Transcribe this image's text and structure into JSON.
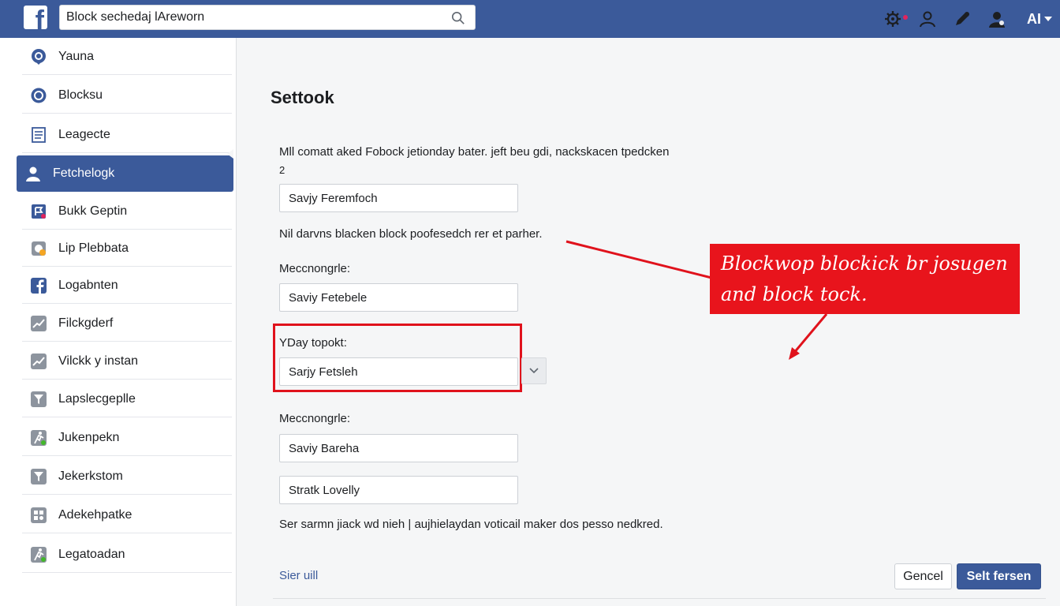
{
  "header": {
    "logo": "f",
    "search_value": "Block sechedaj lAreworn",
    "account_label": "AI",
    "icons": [
      "search-icon",
      "gear-icon",
      "user-icon",
      "edit-icon",
      "people-icon"
    ],
    "brand_color": "#3b5a9a"
  },
  "sidebar": {
    "items": [
      {
        "label": "Yauna",
        "icon": "chat-icon"
      },
      {
        "label": "Blocksu",
        "icon": "circle-icon"
      },
      {
        "label": "Leagecte",
        "icon": "list-icon"
      },
      {
        "label": "Fetchelogk",
        "icon": "user-icon",
        "active": true
      },
      {
        "label": "Bukk Geptin",
        "icon": "flag-icon"
      },
      {
        "label": "Lip Plebbata",
        "icon": "badge-icon"
      },
      {
        "label": "Logabnten",
        "icon": "facebook-icon"
      },
      {
        "label": "Filckgderf",
        "icon": "chart-icon"
      },
      {
        "label": "Vilckk y instan",
        "icon": "chart-icon"
      },
      {
        "label": "Lapslecgeplle",
        "icon": "filter-icon"
      },
      {
        "label": "Jukenpekn",
        "icon": "run-icon"
      },
      {
        "label": "Jekerkstom",
        "icon": "filter-icon"
      },
      {
        "label": "Adekehpatke",
        "icon": "grid-icon"
      },
      {
        "label": "Legatoadan",
        "icon": "run-icon"
      }
    ]
  },
  "main": {
    "title": "Settook",
    "intro_line1": "Mll comatt aked Fobock jetionday bater. jeft beu gdi, nackskacen tpedcken",
    "intro_line2": "2",
    "field1_value": "Savjy Feremfoch",
    "description": "Nil darvns blacken block poofesedch rer et parher.",
    "label1": "Meccnongrle:",
    "field2_value": "Saviy Fetebele",
    "label_highlight": "YDay topokt:",
    "field_highlight_value": "Sarjy Fetsleh",
    "label2": "Meccnongrle:",
    "field3_value": "Saviy Bareha",
    "field4_value": "Stratk Lovelly",
    "footer_note": "Ser sarmn jiack wd nieh | aujhielaydan voticail maker dos pesso nedkred.",
    "link": "Sier uill",
    "cancel_label": "Gencel",
    "primary_label": "Selt fersen"
  },
  "callout": {
    "text": "Blockwop blockick br josugen and block tock.",
    "color": "#e8141c"
  }
}
